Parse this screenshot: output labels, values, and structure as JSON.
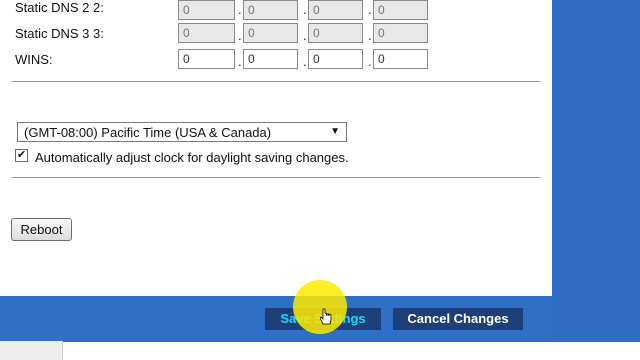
{
  "dns": {
    "static_dns_2": {
      "label": "Static DNS 2 2:",
      "octets": [
        "0",
        "0",
        "0",
        "0"
      ]
    },
    "static_dns_3": {
      "label": "Static DNS 3 3:",
      "octets": [
        "0",
        "0",
        "0",
        "0"
      ]
    },
    "wins": {
      "label": "WINS:",
      "octets": [
        "0",
        "0",
        "0",
        "0"
      ]
    },
    "separator": "."
  },
  "time": {
    "timezone_selected": "(GMT-08:00) Pacific Time (USA & Canada)",
    "daylight_checked": true,
    "daylight_label": "Automatically adjust clock for daylight saving changes."
  },
  "actions": {
    "reboot_label": "Reboot",
    "save_label": "Save Settings",
    "cancel_label": "Cancel Changes"
  },
  "colors": {
    "brand_blue": "#2e6fc7",
    "button_dark": "#1f3f7a",
    "highlight": "#ffeb00"
  },
  "icons": {
    "dropdown": "triangle-down",
    "cursor": "hand-pointer"
  }
}
